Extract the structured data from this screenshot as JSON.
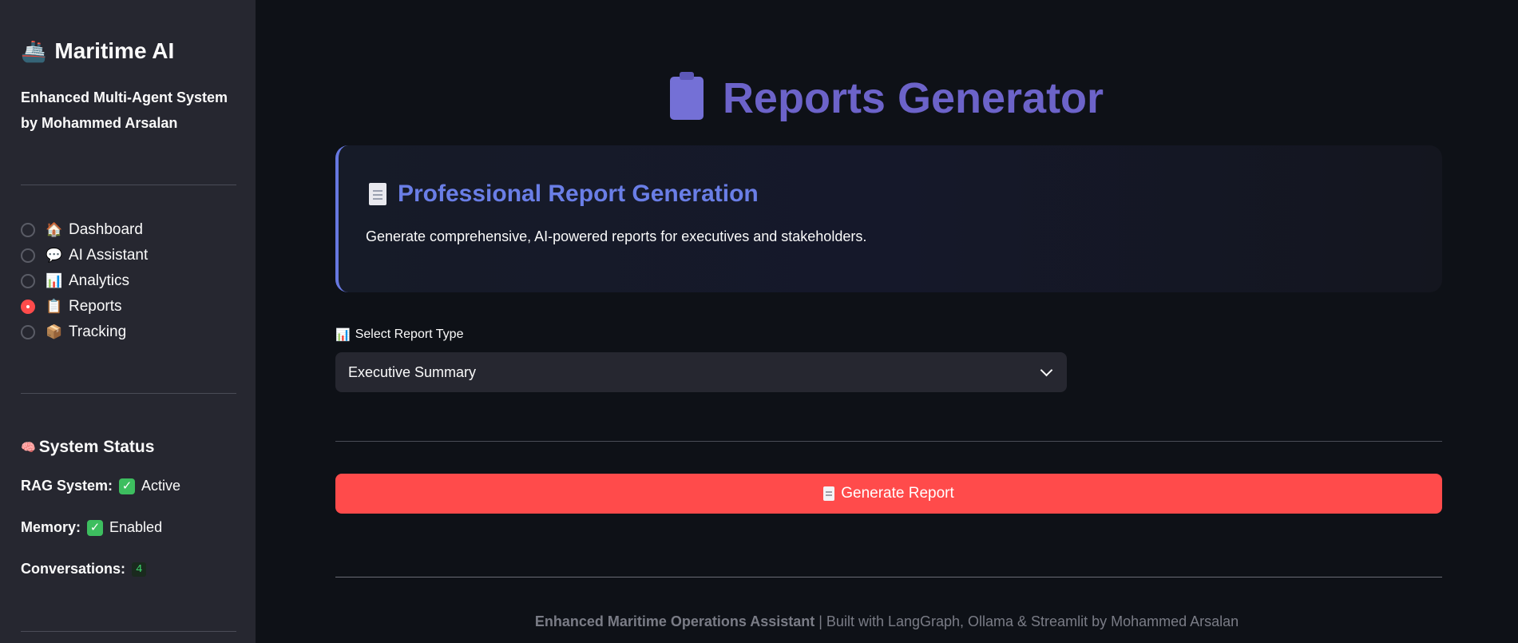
{
  "sidebar": {
    "brand": {
      "icon": "ship-icon",
      "icon_glyph": "🚢",
      "title": "Maritime AI"
    },
    "subtitle": "Enhanced Multi-Agent System by Mohammed Arsalan",
    "nav": {
      "items": [
        {
          "icon": "house-icon",
          "glyph": "🏠",
          "label": "Dashboard",
          "selected": false
        },
        {
          "icon": "speech-bubble-icon",
          "glyph": "💬",
          "label": "AI Assistant",
          "selected": false
        },
        {
          "icon": "bar-chart-icon",
          "glyph": "📊",
          "label": "Analytics",
          "selected": false
        },
        {
          "icon": "clipboard-icon",
          "glyph": "📋",
          "label": "Reports",
          "selected": true
        },
        {
          "icon": "package-icon",
          "glyph": "📦",
          "label": "Tracking",
          "selected": false
        }
      ]
    },
    "status": {
      "icon": "brain-icon",
      "icon_glyph": "🧠",
      "title": "System Status",
      "rag_label": "RAG System:",
      "rag_value": "Active",
      "memory_label": "Memory:",
      "memory_value": "Enabled",
      "conversations_label": "Conversations:",
      "conversations_count": "4"
    }
  },
  "main": {
    "page_title": "Reports Generator",
    "info_card": {
      "title": "Professional Report Generation",
      "description": "Generate comprehensive, AI-powered reports for executives and stakeholders."
    },
    "report_type": {
      "label_icon": "bar-chart-icon",
      "label_glyph": "📊",
      "label": "Select Report Type",
      "selected_value": "Executive Summary"
    },
    "generate_button": {
      "label": "Generate Report"
    },
    "footer": {
      "bold": "Enhanced Maritime Operations Assistant",
      "rest": " | Built with LangGraph, Ollama & Streamlit by Mohammed Arsalan"
    }
  },
  "colors": {
    "background": "#0e1117",
    "sidebar": "#262730",
    "accent_red": "#ff4b4b",
    "title_purple": "#6c63c9",
    "card_title_blue": "#6a7ee6",
    "success_green": "#3dbe5f"
  }
}
